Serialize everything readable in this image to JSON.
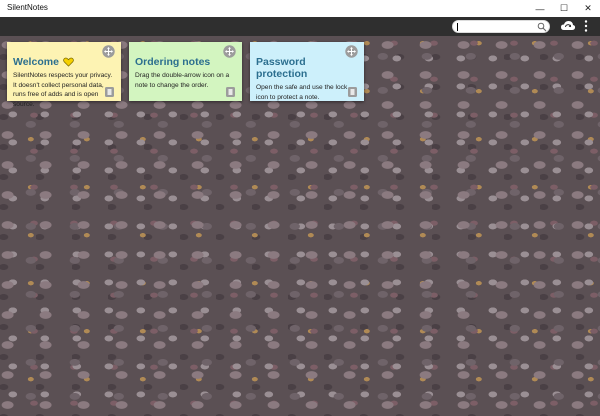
{
  "window": {
    "title": "SilentNotes",
    "controls": {
      "minimize": "—",
      "maximize": "☐",
      "close": "✕"
    }
  },
  "toolbar": {
    "search_value": "",
    "icons": [
      "search-icon",
      "cloud-sync-icon",
      "kebab-menu-icon"
    ]
  },
  "notes": [
    {
      "title": "Welcome",
      "body": "SilentNotes respects your privacy. It doesn't collect personal data, runs free of adds and is open source.",
      "color": "#fdf3b3",
      "icons": [
        "heart-icon",
        "move-icon",
        "trash-icon"
      ]
    },
    {
      "title": "Ordering notes",
      "body": "Drag the double-arrow icon on a note to change the order.",
      "color": "#d3f5c0",
      "icons": [
        "move-icon",
        "trash-icon"
      ]
    },
    {
      "title": "Password protection",
      "body": "Open the safe and use the lock icon to protect a note.",
      "color": "#cdf0fb",
      "icons": [
        "move-icon",
        "trash-icon"
      ]
    }
  ],
  "colors": {
    "title_bar": "#ffffff",
    "toolbar": "#2f2f2f",
    "note_title": "#2c6f8f",
    "heart": "#f5d000"
  }
}
